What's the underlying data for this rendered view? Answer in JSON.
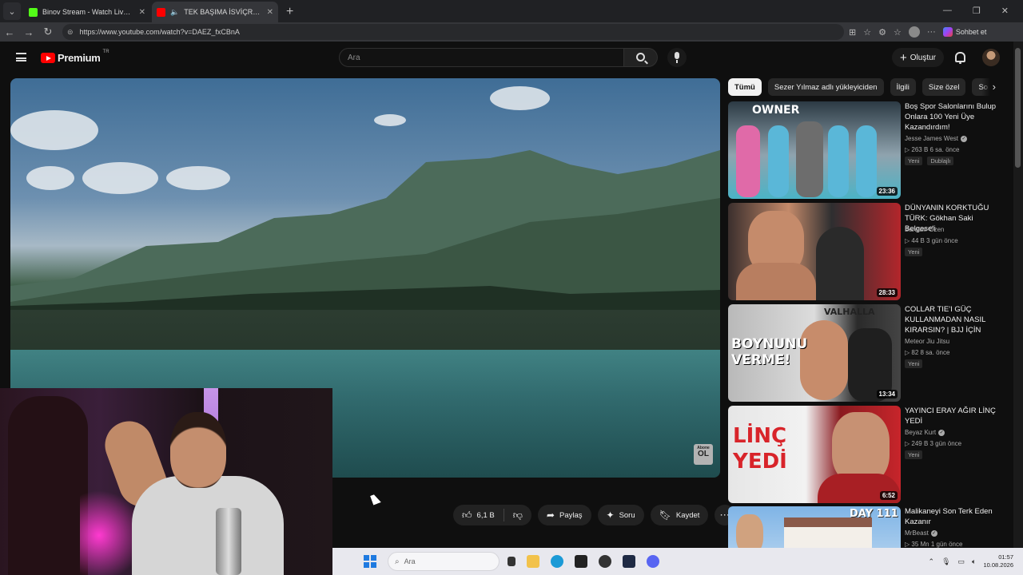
{
  "browser": {
    "tabs": [
      {
        "title": "Binov Stream - Watch Live on Kick",
        "active": false,
        "favicon_color": "#53fc18"
      },
      {
        "title": "TEK BAŞIMA İSVİÇRE KÖYLERİ",
        "active": true,
        "favicon_color": "#ff0000"
      }
    ],
    "url": "https://www.youtube.com/watch?v=DAEZ_fxCBnA",
    "chat_label": "Sohbet et"
  },
  "header": {
    "logo_text": "Premium",
    "region": "TR",
    "search_placeholder": "Ara",
    "create_label": "Oluştur"
  },
  "player": {
    "subscribe_badge_small": "Abone",
    "subscribe_badge_big": "OL"
  },
  "actions": {
    "like_count": "6,1 B",
    "share_label": "Paylaş",
    "ask_label": "Soru",
    "save_label": "Kaydet"
  },
  "chips": [
    "Tümü",
    "Sezer Yılmaz adlı yükleyiciden",
    "İlgili",
    "Size özel",
    "So"
  ],
  "recommendations": [
    {
      "title": "Boş Spor Salonlarını Bulup Onlara 100 Yeni Üye Kazandırdım!",
      "channel": "Jesse James West",
      "verified": true,
      "meta": "▷ 263 B   6 sa. önce",
      "badges": [
        "Yeni",
        "Dublajlı"
      ],
      "duration": "23:36",
      "thumb_text": "OWNER"
    },
    {
      "title": "DÜNYANIN KORKTUĞU TÜRK: Gökhan Saki Belgeseli",
      "channel": "Bahadır Özen",
      "verified": false,
      "meta": "▷ 44 B   3 gün önce",
      "badges": [
        "Yeni"
      ],
      "duration": "28:33",
      "thumb_text": ""
    },
    {
      "title": "COLLAR TIE'I GÜÇ KULLANMADAN NASIL KIRARSIN? | BJJ İÇİN GÜRE…",
      "channel": "Meteor Jiu Jitsu",
      "verified": false,
      "meta": "▷ 82   8 sa. önce",
      "badges": [
        "Yeni"
      ],
      "duration": "13:34",
      "thumb_text": "BOYNUNU VERME!",
      "thumb_text_top": "VALHALLA"
    },
    {
      "title": "YAYINCI ERAY AĞIR LİNÇ YEDİ",
      "channel": "Beyaz Kurt",
      "verified": true,
      "meta": "▷ 249 B   3 gün önce",
      "badges": [
        "Yeni"
      ],
      "duration": "6:52",
      "thumb_text": "LİNÇ YEDİ"
    },
    {
      "title": "Malikaneyi Son Terk Eden Kazanır",
      "channel": "MrBeast",
      "verified": true,
      "meta": "▷ 35 Mn   1 gün önce",
      "badges": [],
      "duration": "",
      "thumb_text": "DAY 111"
    }
  ],
  "taskbar": {
    "search_placeholder": "Ara",
    "time": "01:57",
    "date": "10.08.2026"
  }
}
